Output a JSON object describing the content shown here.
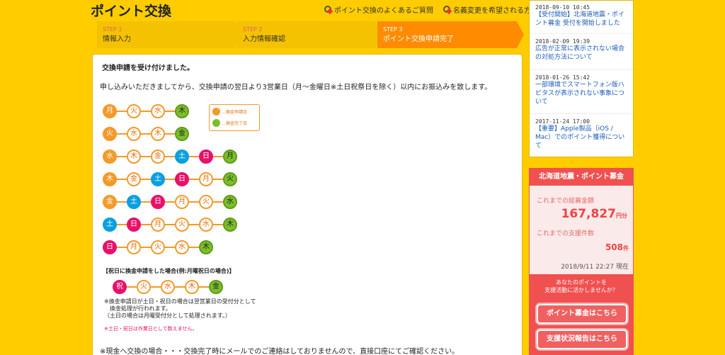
{
  "header": {
    "title": "ポイント交換",
    "links": [
      "ポイント交換のよくあるご質問",
      "名義変更を希望される方"
    ]
  },
  "steps": [
    {
      "num": "STEP 1",
      "label": "情報入力"
    },
    {
      "num": "STEP 2",
      "label": "入力情報確認"
    },
    {
      "num": "STEP 3",
      "label": "ポイント交換申請完了"
    }
  ],
  "main": {
    "title": "交換申請を受け付けました。",
    "description": "申し込みいただきましてから、交換申請の翌日より3営業日（月～金曜日※土日祝祭日を除く）以内にお振込みを致します。",
    "legend": {
      "start": "…換金申請日",
      "end": "…換金完了日"
    },
    "schedule": [
      [
        "月",
        "火",
        "水",
        "木"
      ],
      [
        "火",
        "水",
        "木",
        "金"
      ],
      [
        "水",
        "木",
        "金",
        "土",
        "日",
        "月"
      ],
      [
        "木",
        "金",
        "土",
        "日",
        "月",
        "火"
      ],
      [
        "金",
        "土",
        "日",
        "月",
        "火",
        "水"
      ],
      [
        "土",
        "日",
        "月",
        "火",
        "水",
        "木"
      ],
      [
        "日",
        "月",
        "火",
        "水",
        "木"
      ]
    ],
    "holiday_head": "【祝日に換金申請をした場合(例:月曜祝日の場合)】",
    "holiday_row": [
      "祝",
      "火",
      "水",
      "木",
      "金"
    ],
    "holiday_note": [
      "※換金申請日が土日・祝日の場合は翌営業日の受付分として",
      "　換金処理が行われます。",
      "（土日の場合は月曜受付分として処理されます。）"
    ],
    "holiday_note2": "※土日・祝日は作業日として数えません。",
    "footer_note": "※現金へ交換の場合・・・交換完了時にメールでのご連絡はしておりませんので、直接口座にてご確認ください。"
  },
  "news": [
    {
      "date": "2018-09-10 10:45",
      "text": "【受付開始】北海道地震・ポイント募金 受付を開始しました"
    },
    {
      "date": "2018-02-09 19:39",
      "text": "広告が正常に表示されない場合の対処方法について"
    },
    {
      "date": "2018-01-26 15:42",
      "text": "一部環境でスマートフォン版ハピタスが表示されない事象について"
    },
    {
      "date": "2017-11-24 17:00",
      "text": "【重要】Apple製品（iOS / Mac）でのポイント獲得について"
    }
  ],
  "donation": {
    "title": "北海道地震・ポイント募金",
    "total_label": "これまでの総募金額",
    "total": "167,827",
    "total_unit": "円分",
    "count_label": "これまでの支援件数",
    "count": "508",
    "count_unit": "件",
    "as_of": "2018/9/11 22:27 現在",
    "cta_text": [
      "あなたのポイントを",
      "支援活動に活かしませんか？"
    ],
    "button1": "ポイント募金はこちら",
    "button2": "支援状況報告はこちら"
  },
  "colors": {
    "background": "#ffcc00",
    "step_active": "#ff8c00",
    "donation": "#f05050",
    "end_day": "#7bbf2a",
    "start_day": "#f39a2a"
  }
}
